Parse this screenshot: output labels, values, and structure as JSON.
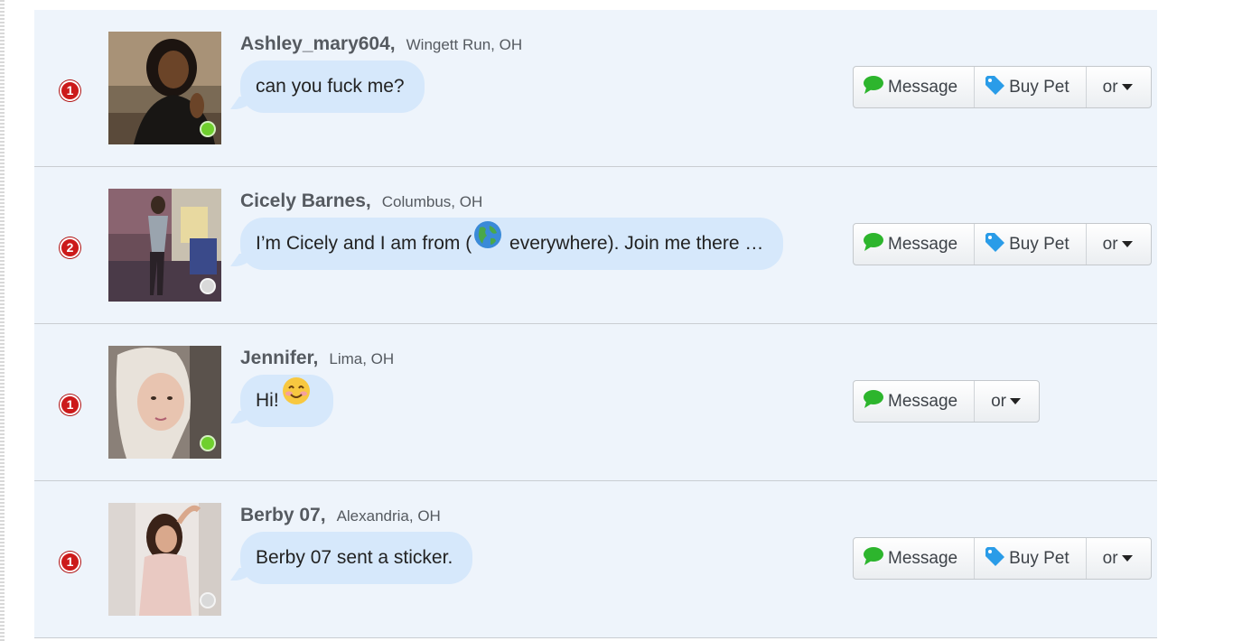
{
  "conversations": [
    {
      "count": "1",
      "name": "Ashley_mary604,",
      "location": "Wingett Run, OH",
      "message": "can you fuck me?",
      "message_end": "",
      "has_globe_emoji": false,
      "has_smile_emoji": false,
      "online": true,
      "show_buy_pet": true
    },
    {
      "count": "2",
      "name": "Cicely Barnes,",
      "location": "Columbus, OH",
      "message": "I’m Cicely and I am from (",
      "message_end": " everywhere). Join me there …",
      "has_globe_emoji": true,
      "has_smile_emoji": false,
      "online": false,
      "show_buy_pet": true
    },
    {
      "count": "1",
      "name": "Jennifer,",
      "location": "Lima, OH",
      "message": "Hi!",
      "message_end": "",
      "has_globe_emoji": false,
      "has_smile_emoji": true,
      "online": true,
      "show_buy_pet": false
    },
    {
      "count": "1",
      "name": "Berby 07,",
      "location": "Alexandria, OH",
      "message": "Berby 07 sent a sticker.",
      "message_end": "",
      "has_globe_emoji": false,
      "has_smile_emoji": false,
      "online": false,
      "show_buy_pet": true
    }
  ],
  "actions": {
    "message_label": "Message",
    "buy_pet_label": "Buy Pet",
    "or_label": "or"
  },
  "icons": {
    "message": "speech-bubble-icon",
    "buy_pet": "price-tag-icon",
    "dropdown": "caret-down-icon",
    "globe": "globe-emoji",
    "smile": "smile-emoji"
  },
  "colors": {
    "row_bg": "#eef4fb",
    "bubble_bg": "#d6e8fb",
    "badge_red": "#cc1a1a",
    "online_green": "#6fcf2e",
    "offline_gray": "#d9d9d9",
    "message_icon_green": "#2db52d",
    "tag_icon_blue": "#2a9ce8"
  }
}
